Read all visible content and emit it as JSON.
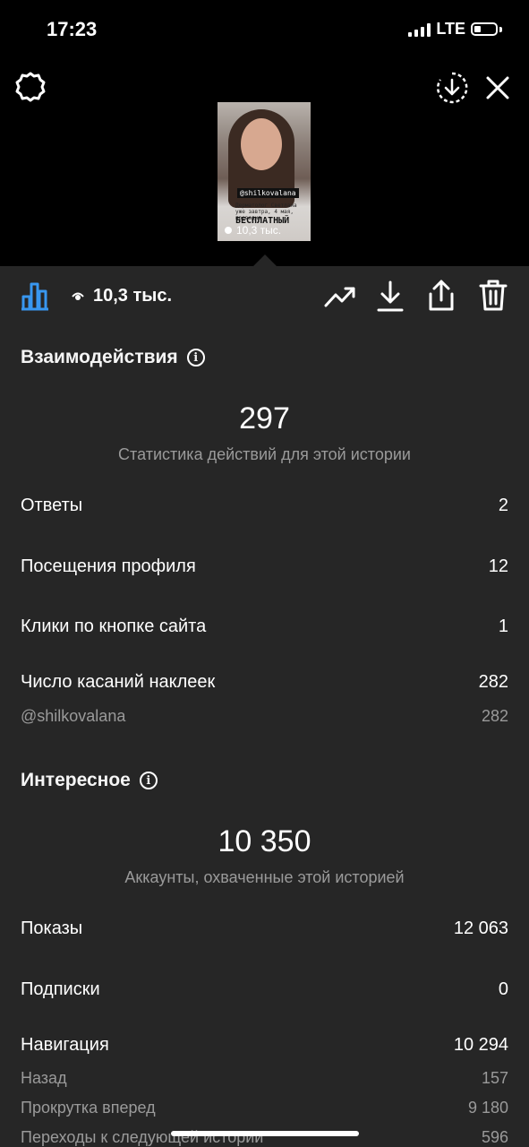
{
  "status": {
    "time": "17:23",
    "network": "LTE"
  },
  "story": {
    "handle": "@shilkovalana",
    "caption_line": "Дерматолог Светлана уже завтра, 4 мая, проводит",
    "headline": "БЕСПЛАТНЫЙ",
    "views": "10,3 тыс."
  },
  "toolbar": {
    "views_label": "10,3 тыс."
  },
  "interactions": {
    "title": "Взаимодействия",
    "total": "297",
    "caption": "Статистика действий для этой истории",
    "rows": [
      {
        "label": "Ответы",
        "value": "2"
      },
      {
        "label": "Посещения профиля",
        "value": "12"
      },
      {
        "label": "Клики по кнопке сайта",
        "value": "1"
      },
      {
        "label": "Число касаний наклеек",
        "value": "282"
      }
    ],
    "sticker_sub": {
      "label": "@shilkovalana",
      "value": "282"
    }
  },
  "discovery": {
    "title": "Интересное",
    "total": "10 350",
    "caption": "Аккаунты, охваченные этой историей",
    "rows": [
      {
        "label": "Показы",
        "value": "12 063"
      },
      {
        "label": "Подписки",
        "value": "0"
      },
      {
        "label": "Навигация",
        "value": "10 294"
      }
    ],
    "nav_sub": [
      {
        "label": "Назад",
        "value": "157"
      },
      {
        "label": "Прокрутка вперед",
        "value": "9 180"
      },
      {
        "label": "Переходы к следующей истории",
        "value": "596"
      }
    ]
  },
  "icons": [
    "settings-icon",
    "download-circle-icon",
    "close-icon",
    "bar-chart-icon",
    "eye-icon",
    "trending-icon",
    "download-icon",
    "share-icon",
    "trash-icon",
    "info-icon"
  ],
  "colors": {
    "accent": "#3897f0",
    "background": "#262626",
    "secondary_text": "#9a9a9a"
  }
}
